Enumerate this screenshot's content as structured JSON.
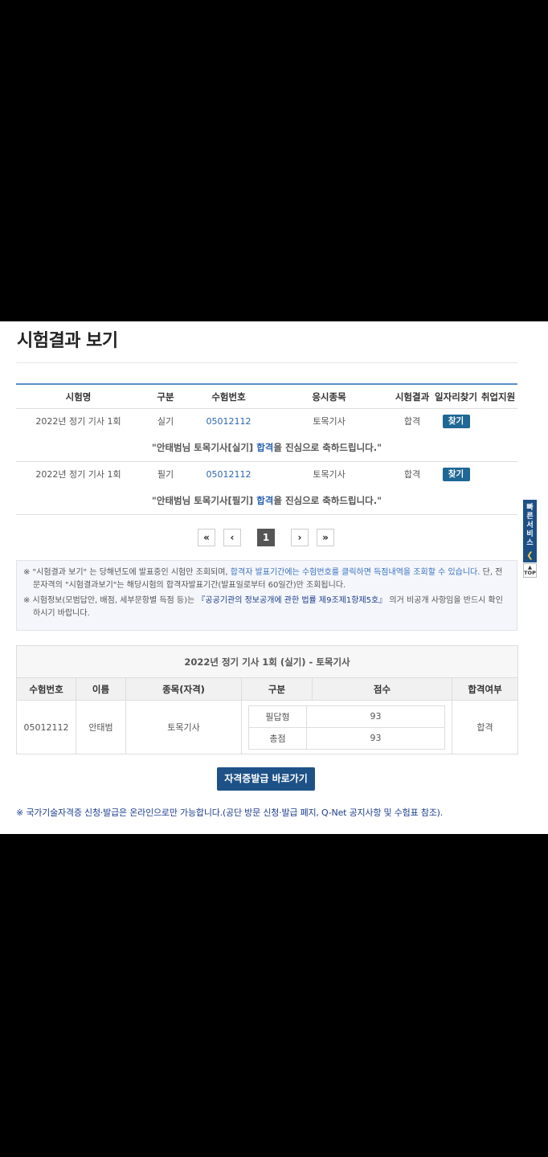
{
  "page": {
    "title": "시험결과 보기"
  },
  "results": {
    "headers": [
      "시험명",
      "구분",
      "수험번호",
      "응시종목",
      "시험결과",
      "일자리찾기",
      "취업지원"
    ],
    "rows": [
      {
        "exam": "2022년 정기 기사 1회",
        "type": "실기",
        "number": "05012112",
        "field": "토목기사",
        "result": "합격",
        "find": "찾기",
        "msg_pre": "\"안태범님 토목기사[실기] ",
        "msg_hl": "합격",
        "msg_post": "을 진심으로 축하드립니다.\""
      },
      {
        "exam": "2022년 정기 기사 1회",
        "type": "필기",
        "number": "05012112",
        "field": "토목기사",
        "result": "합격",
        "find": "찾기",
        "msg_pre": "\"안태범님 토목기사[필기] ",
        "msg_hl": "합격",
        "msg_post": "을 진심으로 축하드립니다.\""
      }
    ]
  },
  "pager": {
    "first": "«",
    "prev": "‹",
    "current": "1",
    "next": "›",
    "last": "»"
  },
  "notice": {
    "n1_a": "※ \"시험결과 보기\" 는 당해년도에 발표중인 시험만 조회되며, ",
    "n1_b": "합격자 발표기간에는 수험번호를 클릭하면 득점내역을 조회할 수 있습니다.",
    "n1_c": " 단, 전문자격의 \"시험결과보기\"는 해당시험의 합격자발표기간(발표일로부터 60일간)만 조회됩니다.",
    "n2_a": "※ 시험정보(모범답안, 배점, 세부문항별 득점 등)는 ",
    "n2_b": "『공공기관의 정보공개에 관한 법률 제9조제1항제5호』",
    "n2_c": " 의거 비공개 사항임을 반드시 확인하시기 바랍니다."
  },
  "side": {
    "quick": [
      "빠",
      "른",
      "서",
      "비",
      "스"
    ],
    "top": "TOP"
  },
  "detail": {
    "title": "2022년 정기 기사 1회 (실기) - 토목기사",
    "headers": [
      "수험번호",
      "이름",
      "종목(자격)",
      "구분",
      "점수",
      "합격여부"
    ],
    "number": "05012112",
    "name": "안태범",
    "field": "토목기사",
    "rows": [
      {
        "kind": "필답형",
        "score": "93"
      },
      {
        "kind": "총점",
        "score": "93"
      }
    ],
    "pass": "합격"
  },
  "cert_button": "자격증발급 바로가기",
  "footnote": "※ 국가기술자격증 신청·발급은 온라인으로만 가능합니다.(공단 방문 신청·발급 폐지, Q-Net 공지사항 및 수험표 참조)."
}
